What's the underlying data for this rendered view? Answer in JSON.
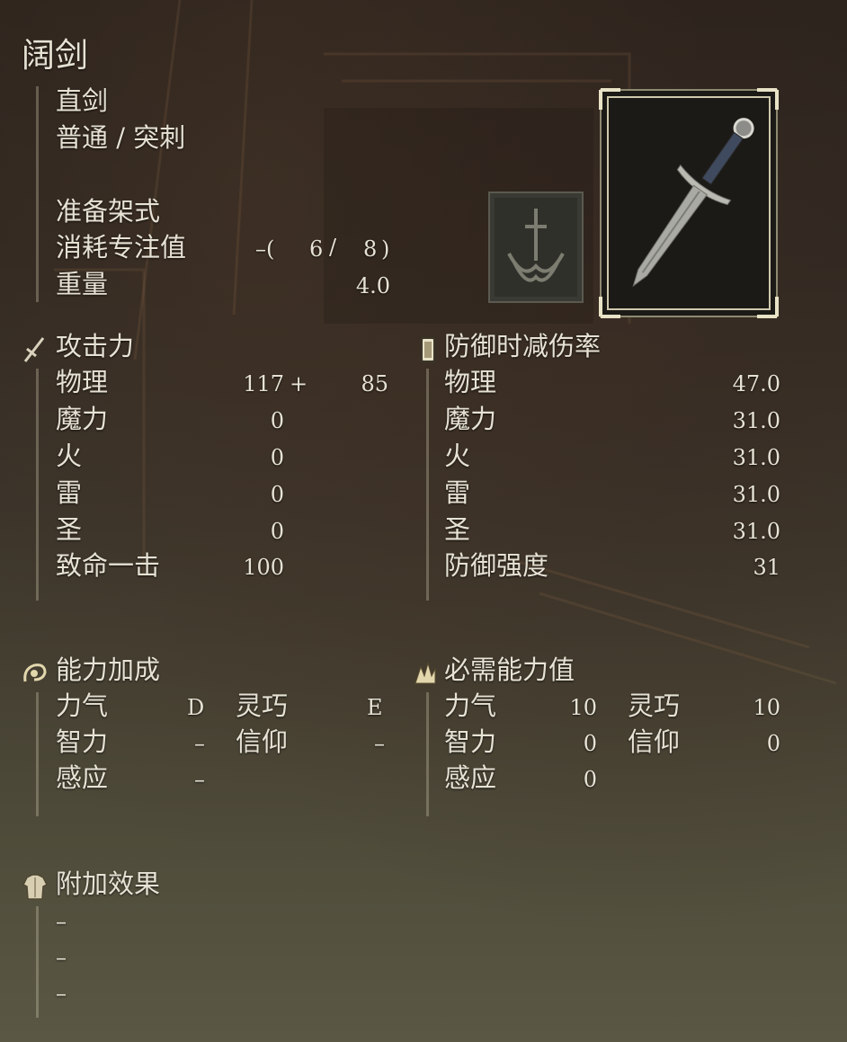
{
  "weapon": {
    "name": "阔剑",
    "type": "直剑",
    "attack_type": "普通 / 突刺",
    "skill": "准备架式",
    "fp_cost": {
      "label": "消耗专注值",
      "prefix": "–(",
      "value1": "6",
      "slash": "/",
      "value2": "8",
      "suffix": ")"
    },
    "weight": {
      "label": "重量",
      "value": "4.0"
    }
  },
  "attack": {
    "title": "攻击力",
    "icon": "sword-icon",
    "rows": [
      {
        "label": "物理",
        "value": "117",
        "plus": "+",
        "bonus": "85"
      },
      {
        "label": "魔力",
        "value": "0"
      },
      {
        "label": "火",
        "value": "0"
      },
      {
        "label": "雷",
        "value": "0"
      },
      {
        "label": "圣",
        "value": "0"
      },
      {
        "label": "致命一击",
        "value": "100"
      }
    ]
  },
  "guard": {
    "title": "防御时减伤率",
    "icon": "shield-icon",
    "rows": [
      {
        "label": "物理",
        "value": "47.0"
      },
      {
        "label": "魔力",
        "value": "31.0"
      },
      {
        "label": "火",
        "value": "31.0"
      },
      {
        "label": "雷",
        "value": "31.0"
      },
      {
        "label": "圣",
        "value": "31.0"
      },
      {
        "label": "防御强度",
        "value": "31"
      }
    ]
  },
  "scaling": {
    "title": "能力加成",
    "icon": "scaling-icon",
    "rows": [
      {
        "label1": "力气",
        "value1": "D",
        "label2": "灵巧",
        "value2": "E"
      },
      {
        "label1": "智力",
        "value1": "–",
        "label2": "信仰",
        "value2": "–"
      },
      {
        "label1": "感应",
        "value1": "–"
      }
    ]
  },
  "requirements": {
    "title": "必需能力值",
    "icon": "requirement-icon",
    "rows": [
      {
        "label1": "力气",
        "value1": "10",
        "label2": "灵巧",
        "value2": "10"
      },
      {
        "label1": "智力",
        "value1": "0",
        "label2": "信仰",
        "value2": "0"
      },
      {
        "label1": "感应",
        "value1": "0"
      }
    ]
  },
  "effects": {
    "title": "附加效果",
    "icon": "armor-icon",
    "items": [
      "–",
      "–",
      "–"
    ]
  },
  "colors": {
    "text": "#e6e2d4",
    "frame": "#cfc9ad"
  }
}
